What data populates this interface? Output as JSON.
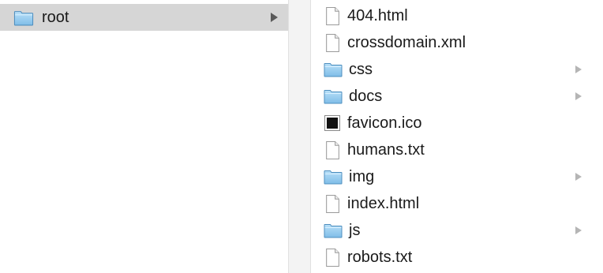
{
  "browser": {
    "column1": {
      "items": [
        {
          "label": "root",
          "icon": "folder-icon",
          "selected": true,
          "has_children": true
        }
      ]
    },
    "column2": {
      "items": [
        {
          "label": "404.html",
          "icon": "document-icon",
          "has_children": false
        },
        {
          "label": "crossdomain.xml",
          "icon": "document-icon",
          "has_children": false
        },
        {
          "label": "css",
          "icon": "folder-icon",
          "has_children": true
        },
        {
          "label": "docs",
          "icon": "folder-icon",
          "has_children": true
        },
        {
          "label": "favicon.ico",
          "icon": "black-square-icon",
          "has_children": false
        },
        {
          "label": "humans.txt",
          "icon": "document-icon",
          "has_children": false
        },
        {
          "label": "img",
          "icon": "folder-icon",
          "has_children": true
        },
        {
          "label": "index.html",
          "icon": "document-icon",
          "has_children": false
        },
        {
          "label": "js",
          "icon": "folder-icon",
          "has_children": true
        },
        {
          "label": "robots.txt",
          "icon": "document-icon",
          "has_children": false
        }
      ]
    }
  },
  "colors": {
    "selection": "#d6d6d6",
    "folder": "#8ec8ee"
  }
}
